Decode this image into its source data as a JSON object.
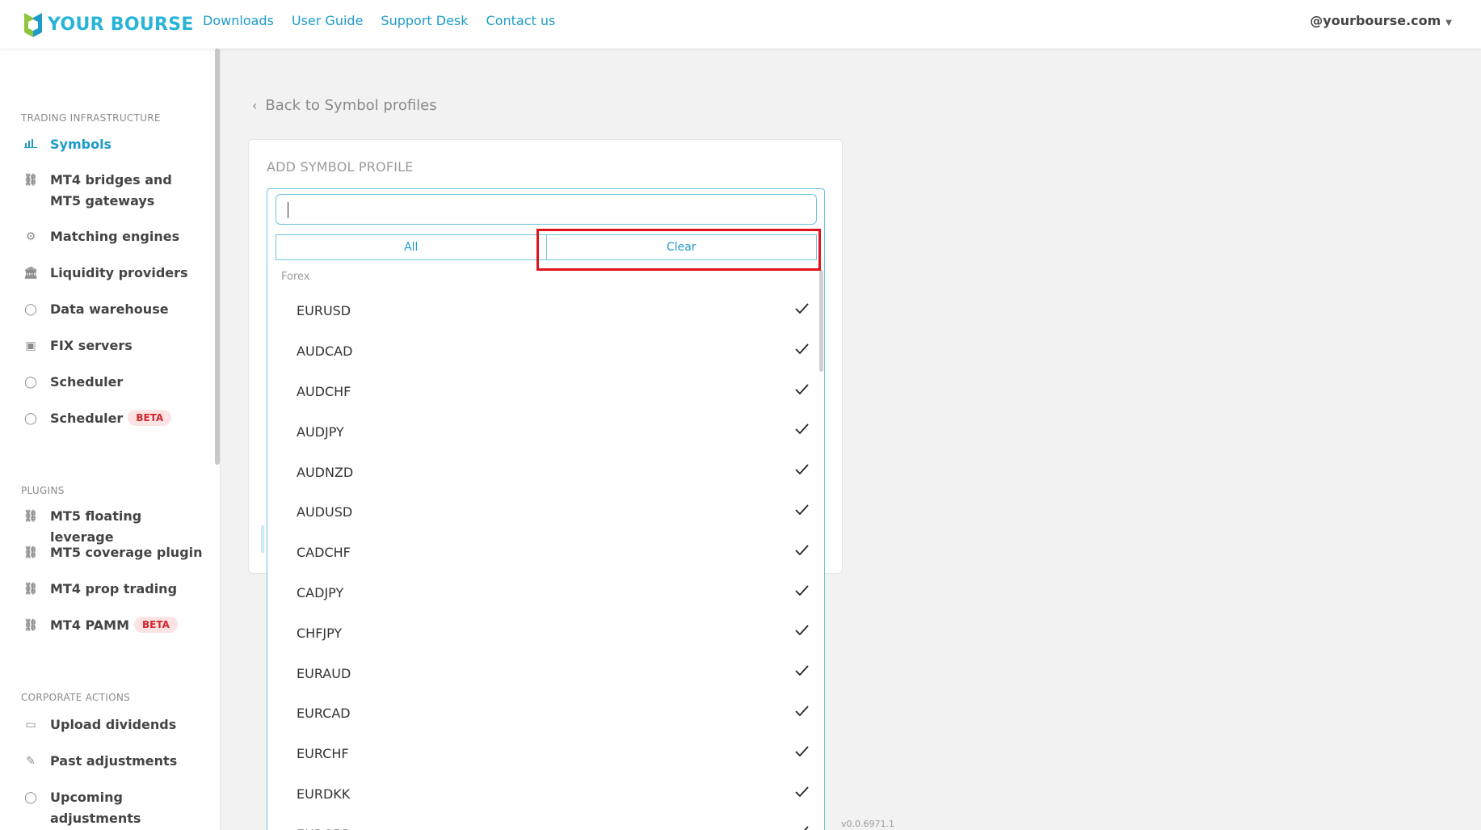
{
  "brand": {
    "name": "YOUR BOURSE",
    "color": "#28b4d7",
    "logo_icon": "hexagon-logo-icon"
  },
  "topnav": {
    "links": [
      "Downloads",
      "User Guide",
      "Support Desk",
      "Contact us"
    ],
    "account": "@yourbourse.com"
  },
  "sidebar": {
    "sections": [
      {
        "label": "TRADING INFRASTRUCTURE",
        "items": [
          {
            "label": "Symbols",
            "icon": "bar-chart-icon",
            "active": true
          },
          {
            "label": "MT4 bridges and MT5 gateways",
            "icon": "bridge-icon"
          },
          {
            "label": "Matching engines",
            "icon": "engine-icon"
          },
          {
            "label": "Liquidity providers",
            "icon": "bank-icon"
          },
          {
            "label": "Data warehouse",
            "icon": "circle-icon"
          },
          {
            "label": "FIX servers",
            "icon": "server-icon"
          },
          {
            "label": "Scheduler",
            "icon": "circle-icon"
          },
          {
            "label": "Scheduler",
            "icon": "circle-icon",
            "badge": "BETA"
          }
        ]
      },
      {
        "label": "PLUGINS",
        "items": [
          {
            "label": "MT5 floating leverage",
            "icon": "bridge-icon"
          },
          {
            "label": "MT5 coverage plugin",
            "icon": "bridge-icon"
          },
          {
            "label": "MT4 prop trading",
            "icon": "bridge-icon"
          },
          {
            "label": "MT4 PAMM",
            "icon": "bridge-icon",
            "badge": "BETA"
          }
        ]
      },
      {
        "label": "CORPORATE ACTIONS",
        "items": [
          {
            "label": "Upload dividends",
            "icon": "folder-icon"
          },
          {
            "label": "Past adjustments",
            "icon": "edit-icon"
          },
          {
            "label": "Upcoming adjustments",
            "icon": "circle-icon"
          }
        ]
      }
    ]
  },
  "main": {
    "back_link": "Back to Symbol profiles",
    "card_title": "ADD SYMBOL PROFILE",
    "dropdown": {
      "search_value": "",
      "all_label": "All",
      "clear_label": "Clear",
      "group_label": "Forex",
      "items": [
        "EURUSD",
        "AUDCAD",
        "AUDCHF",
        "AUDJPY",
        "AUDNZD",
        "AUDUSD",
        "CADCHF",
        "CADJPY",
        "CHFJPY",
        "EURAUD",
        "EURCAD",
        "EURCHF",
        "EURDKK",
        "EURGBP"
      ],
      "selected_icon": "check-icon"
    },
    "version": "v0.0.6971.1"
  },
  "colors": {
    "accent": "#1e9cc9",
    "highlight": "#e1141d",
    "beta_bg": "#fde3e3",
    "beta_text": "#d3262c"
  }
}
